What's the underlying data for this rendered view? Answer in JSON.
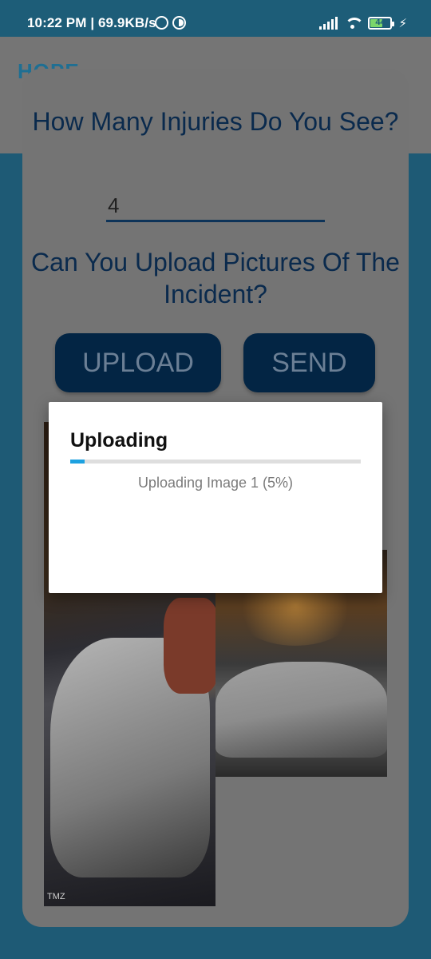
{
  "status_bar": {
    "time_speed": "10:22 PM | 69.9KB/s",
    "battery": "44",
    "icons": [
      "whatsapp-icon",
      "app-circle-icon",
      "signal-icon",
      "wifi-icon",
      "battery-icon",
      "charging-icon"
    ]
  },
  "app_bar": {
    "title": "HOPE"
  },
  "form": {
    "question_injuries": "How Many Injuries Do You See?",
    "injuries_value": "4",
    "question_pictures": "Can You Upload Pictures Of The Incident?",
    "upload_label": "UPLOAD",
    "send_label": "SEND"
  },
  "photos": {
    "watermark": "TMZ"
  },
  "dialog": {
    "title": "Uploading",
    "message": "Uploading Image 1 (5%)",
    "progress_fraction": 0.05
  },
  "colors": {
    "status_bar": "#1d5d78",
    "primary_dark": "#032544",
    "progress": "#1da1e0",
    "dim_overlay_bg": "#747474"
  }
}
